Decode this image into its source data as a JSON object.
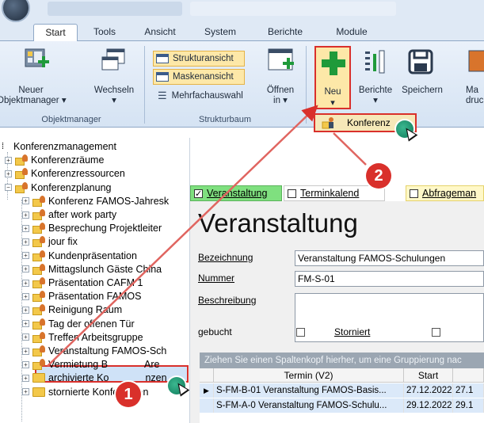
{
  "ribbon_tabs": [
    "Start",
    "Tools",
    "Ansicht",
    "System",
    "Berichte",
    "Module"
  ],
  "ribbon": {
    "objektmanager": {
      "neuer_line1": "Neuer",
      "neuer_line2": "Objektmanager ▾",
      "wechseln_line1": "Wechseln",
      "wechseln_line2": "▾",
      "group": "Objektmanager"
    },
    "strukturbaum": {
      "strukturansicht": "Strukturansicht",
      "maskenansicht": "Maskenansicht",
      "mehrfachauswahl": "Mehrfachauswahl",
      "oeffnen_line1": "Öffnen",
      "oeffnen_line2": "in ▾",
      "group": "Strukturbaum"
    },
    "neu_line1": "Neu",
    "neu_line2": "▾",
    "berichte_line1": "Berichte",
    "berichte_line2": "▾",
    "speichern": "Speichern",
    "ma_line1": "Ma",
    "ma_line2": "druc",
    "konferenz_menu": "Konferenz"
  },
  "tree": {
    "items": [
      {
        "label": "Konferenzmanagement",
        "level": 0
      },
      {
        "label": "Konferenzräume",
        "level": 1
      },
      {
        "label": "Konferenzressourcen",
        "level": 1
      },
      {
        "label": "Konferenzplanung",
        "level": 1
      },
      {
        "label": "Konferenz FAMOS-Jahresk",
        "level": 2
      },
      {
        "label": "after work party",
        "level": 2
      },
      {
        "label": "Besprechung Projektleiter",
        "level": 2
      },
      {
        "label": "jour fix",
        "level": 2
      },
      {
        "label": "Kundenpräsentation",
        "level": 2
      },
      {
        "label": "Mittagslunch Gäste China",
        "level": 2
      },
      {
        "label": "Präsentation CAFM 1",
        "level": 2
      },
      {
        "label": "Präsentation FAMOS",
        "level": 2
      },
      {
        "label": "Reinigung Raum",
        "level": 2
      },
      {
        "label": "Tag der offenen Tür",
        "level": 2
      },
      {
        "label": "Treffen Arbeitsgruppe",
        "level": 2
      },
      {
        "label": "Veranstaltung FAMOS-Sch",
        "level": 2
      },
      {
        "label": "Vermietung B",
        "suffix": "Are",
        "level": 2
      },
      {
        "label": "archivierte Ko",
        "suffix": "nzen",
        "level": 2
      },
      {
        "label": "stornierte Konferenzen",
        "level": 2
      }
    ]
  },
  "right_tabs": [
    {
      "label": "Veranstaltung",
      "checked": true
    },
    {
      "label": "Terminkalend",
      "checked": false
    },
    {
      "label": "Abfrageman",
      "checked": false
    }
  ],
  "form": {
    "title": "Veranstaltung",
    "bezeichnung_label": "Bezeichnung",
    "bezeichnung_value": "Veranstaltung FAMOS-Schulungen",
    "nummer_label": "Nummer",
    "nummer_value": "FM-S-01",
    "beschreibung_label": "Beschreibung",
    "beschreibung_value": "",
    "gebucht_label": "gebucht",
    "storniert_label": "Storniert"
  },
  "grid": {
    "group_hint": "Ziehen Sie einen Spaltenkopf hierher, um eine Gruppierung nac",
    "columns": [
      "Termin (V2)",
      "Start",
      ""
    ],
    "rows": [
      {
        "termin": "S-FM-B-01 Veranstaltung FAMOS-Basis...",
        "start": "27.12.2022",
        "end": "27.1"
      },
      {
        "termin": "S-FM-A-0 Veranstaltung FAMOS-Schulu...",
        "start": "29.12.2022",
        "end": "29.1"
      }
    ]
  },
  "annotations": {
    "step1": "1",
    "step2": "2"
  },
  "colors": {
    "highlight_red": "#d9302b",
    "accent_green": "#3bb78f",
    "tab_green": "#7fe07f"
  }
}
